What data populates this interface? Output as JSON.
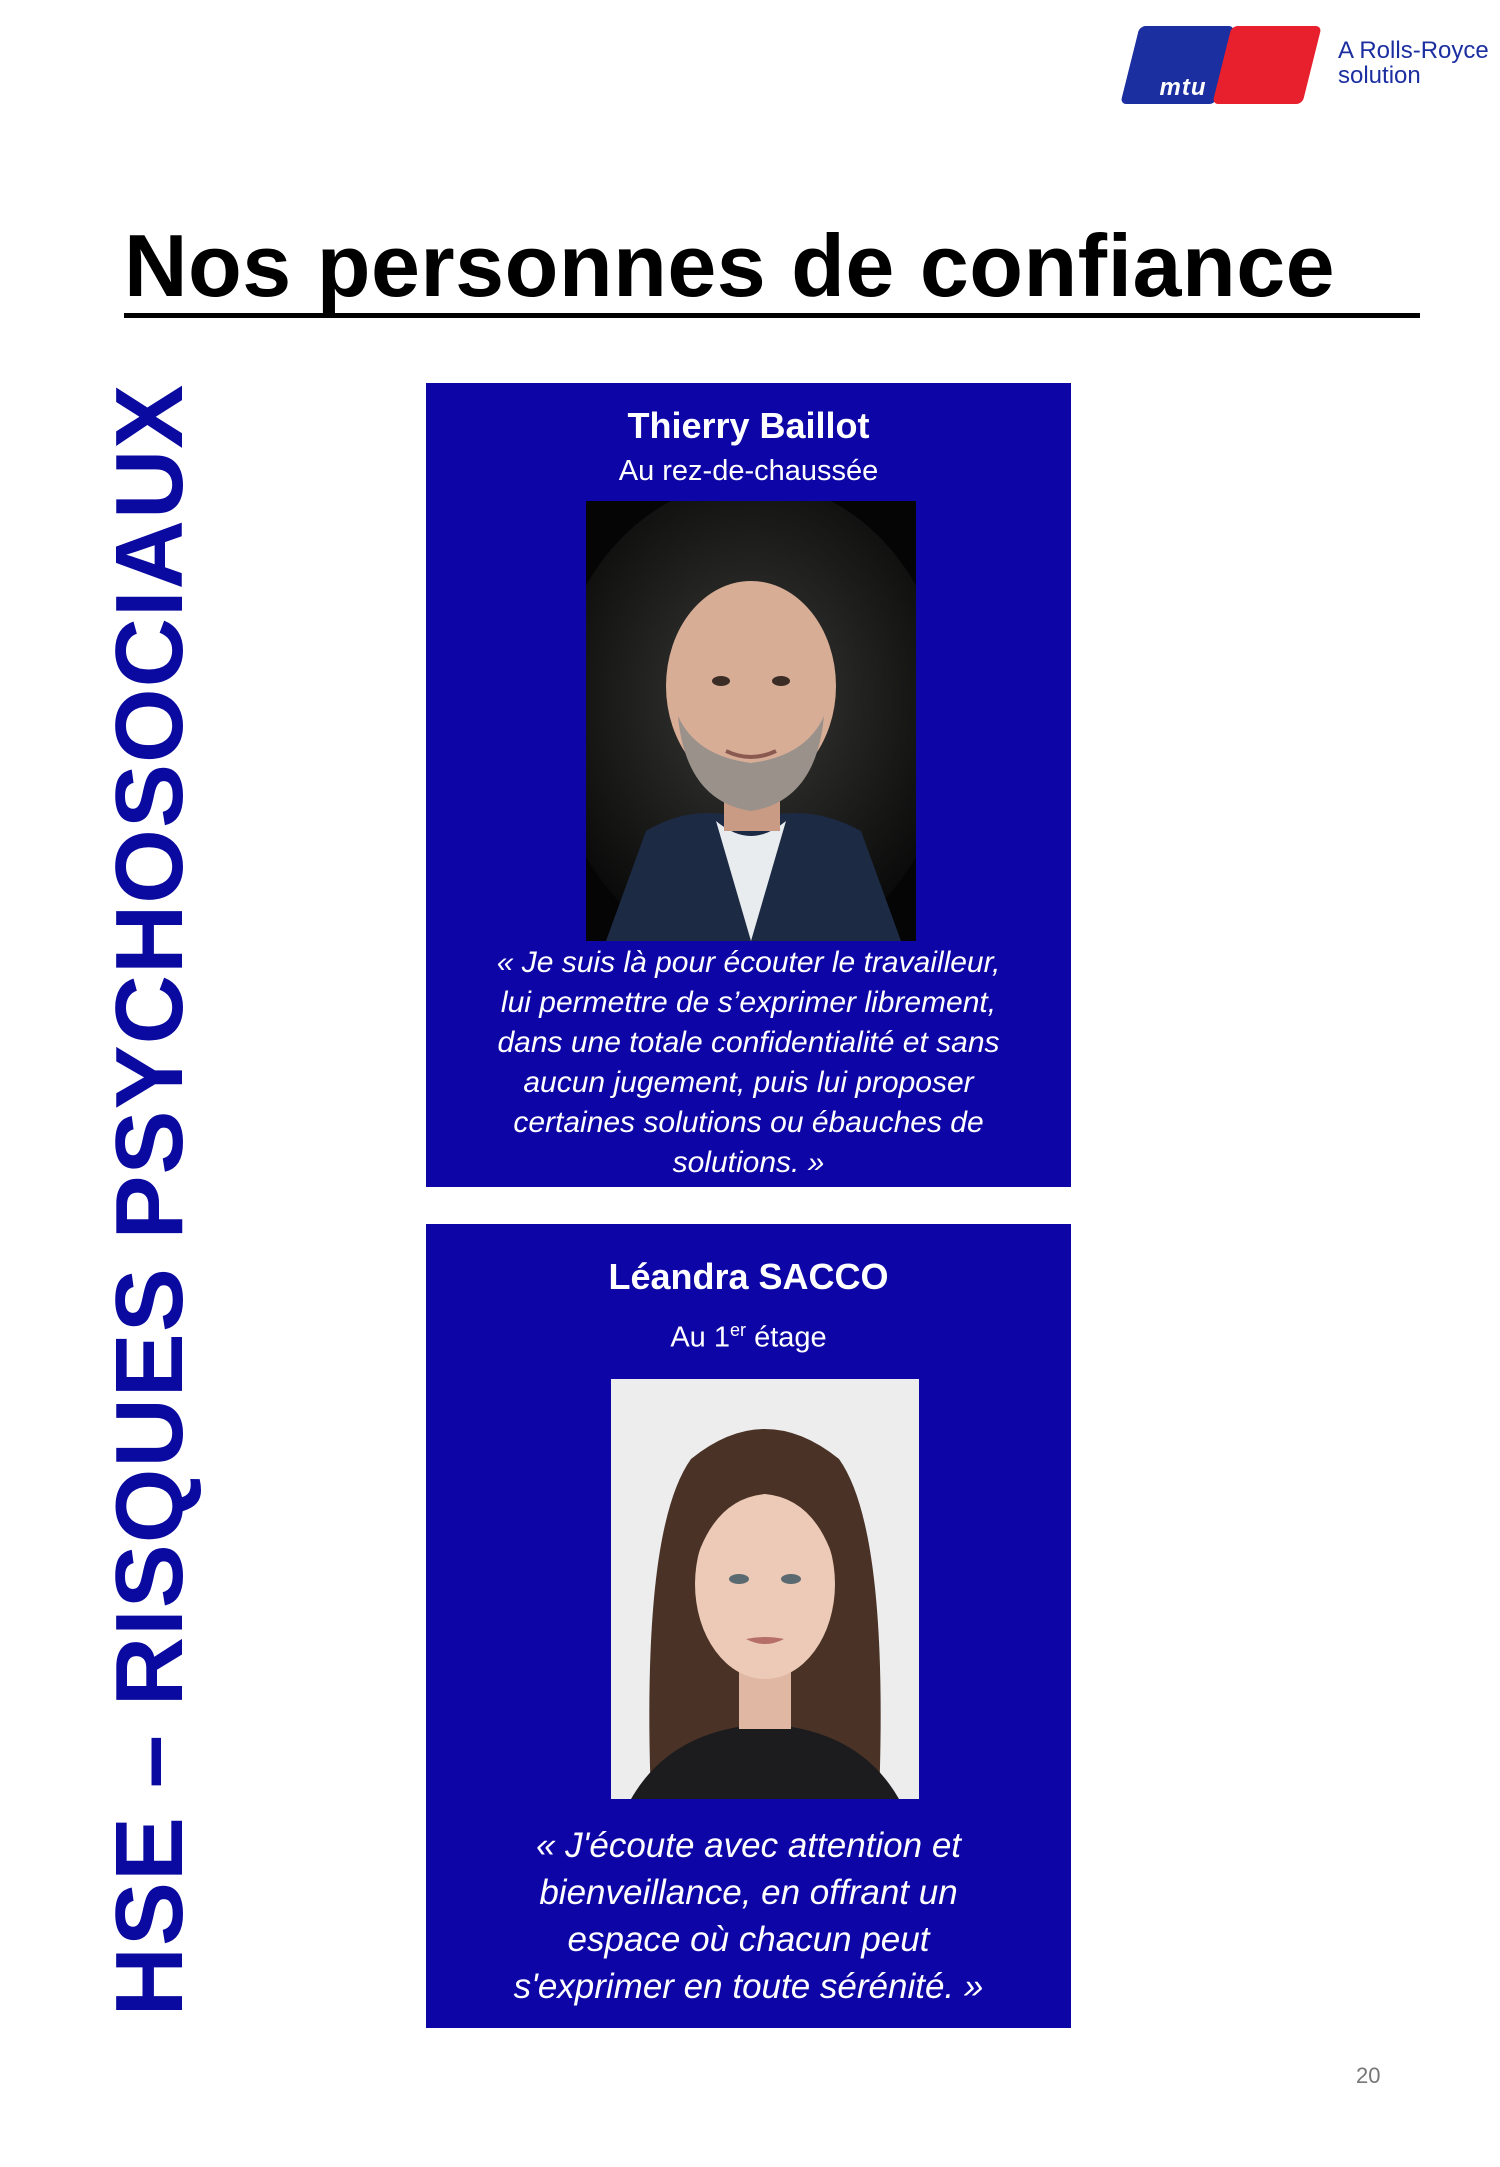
{
  "logo": {
    "brand": "mtu",
    "tagline_line1": "A Rolls-Royce",
    "tagline_line2": "solution",
    "colors": {
      "blue": "#1b2fa0",
      "red": "#e8202e"
    }
  },
  "page": {
    "title": "Nos personnes de confiance",
    "side_heading": "HSE – RISQUES PSYCHOSOCIAUX",
    "page_number": "20",
    "accent_color": "#0d05a6"
  },
  "contacts": [
    {
      "name": "Thierry Baillot",
      "floor": "Au rez-de-chaussée",
      "photo_icon": "portrait-man-photo",
      "quote_lines": [
        "« Je suis là pour écouter le travailleur,",
        "lui permettre de s’exprimer librement,",
        "dans une totale confidentialité et sans",
        "aucun jugement, puis lui proposer",
        "certaines solutions ou ébauches de",
        "solutions. »"
      ]
    },
    {
      "name": "Léandra SACCO",
      "floor_prefix": "Au 1",
      "floor_sup": "er",
      "floor_suffix": " étage",
      "photo_icon": "portrait-woman-photo",
      "quote_lines": [
        "« J'écoute avec attention et",
        "bienveillance, en offrant un",
        "espace où chacun peut",
        "s'exprimer en toute sérénité. »"
      ]
    }
  ]
}
